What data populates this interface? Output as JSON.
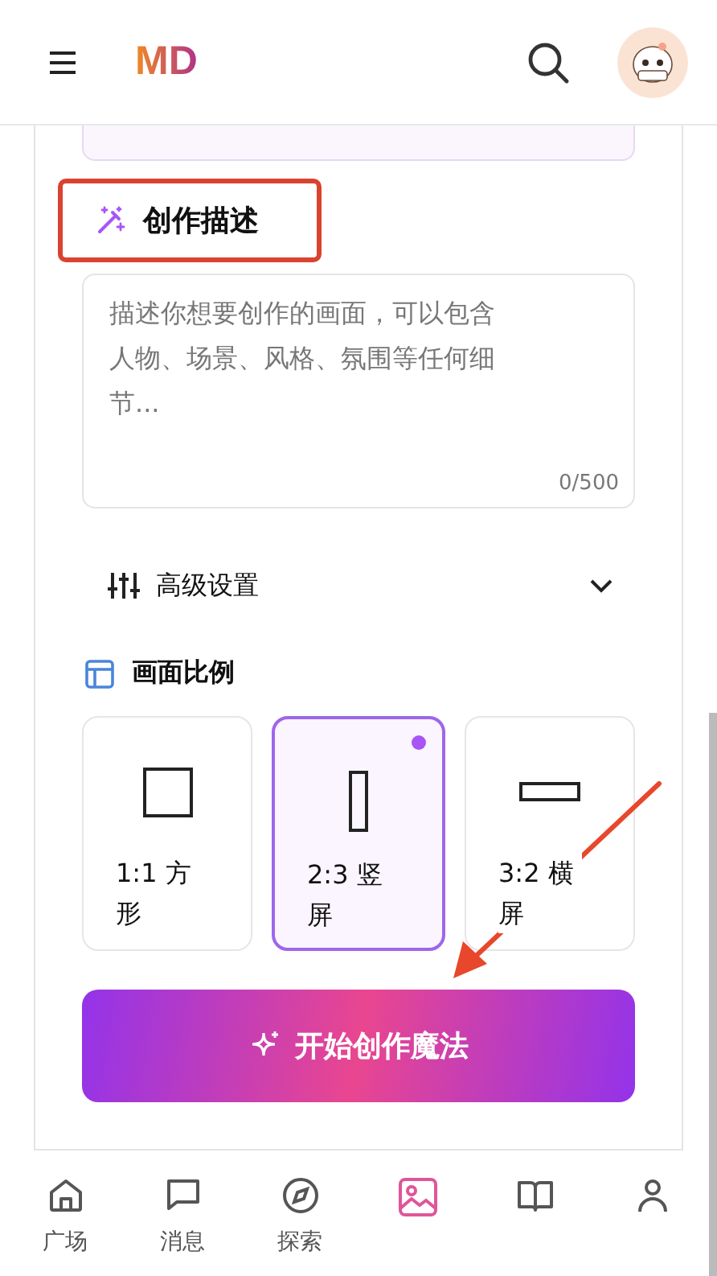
{
  "header": {
    "logo": "MD"
  },
  "prompt": {
    "title": "创作描述",
    "placeholder": "描述你想要创作的画面，可以包含人物、场景、风格、氛围等任何细节...",
    "counter": "0/500"
  },
  "advanced": {
    "label": "高级设置",
    "expanded": false
  },
  "ratio": {
    "title": "画面比例",
    "options": [
      {
        "label": "1:1 方形",
        "kind": "square",
        "selected": false
      },
      {
        "label": "2:3 竖屏",
        "kind": "portrait",
        "selected": true
      },
      {
        "label": "3:2 横屏",
        "kind": "landscape",
        "selected": false
      }
    ]
  },
  "generate_button": "开始创作魔法",
  "tabs": [
    {
      "label": "广场",
      "kind": "home",
      "selected": false
    },
    {
      "label": "消息",
      "kind": "chat",
      "selected": false
    },
    {
      "label": "探索",
      "kind": "compass",
      "selected": false
    },
    {
      "kind": "image",
      "selected": true
    },
    {
      "kind": "book",
      "selected": false
    },
    {
      "kind": "person",
      "selected": false
    }
  ]
}
